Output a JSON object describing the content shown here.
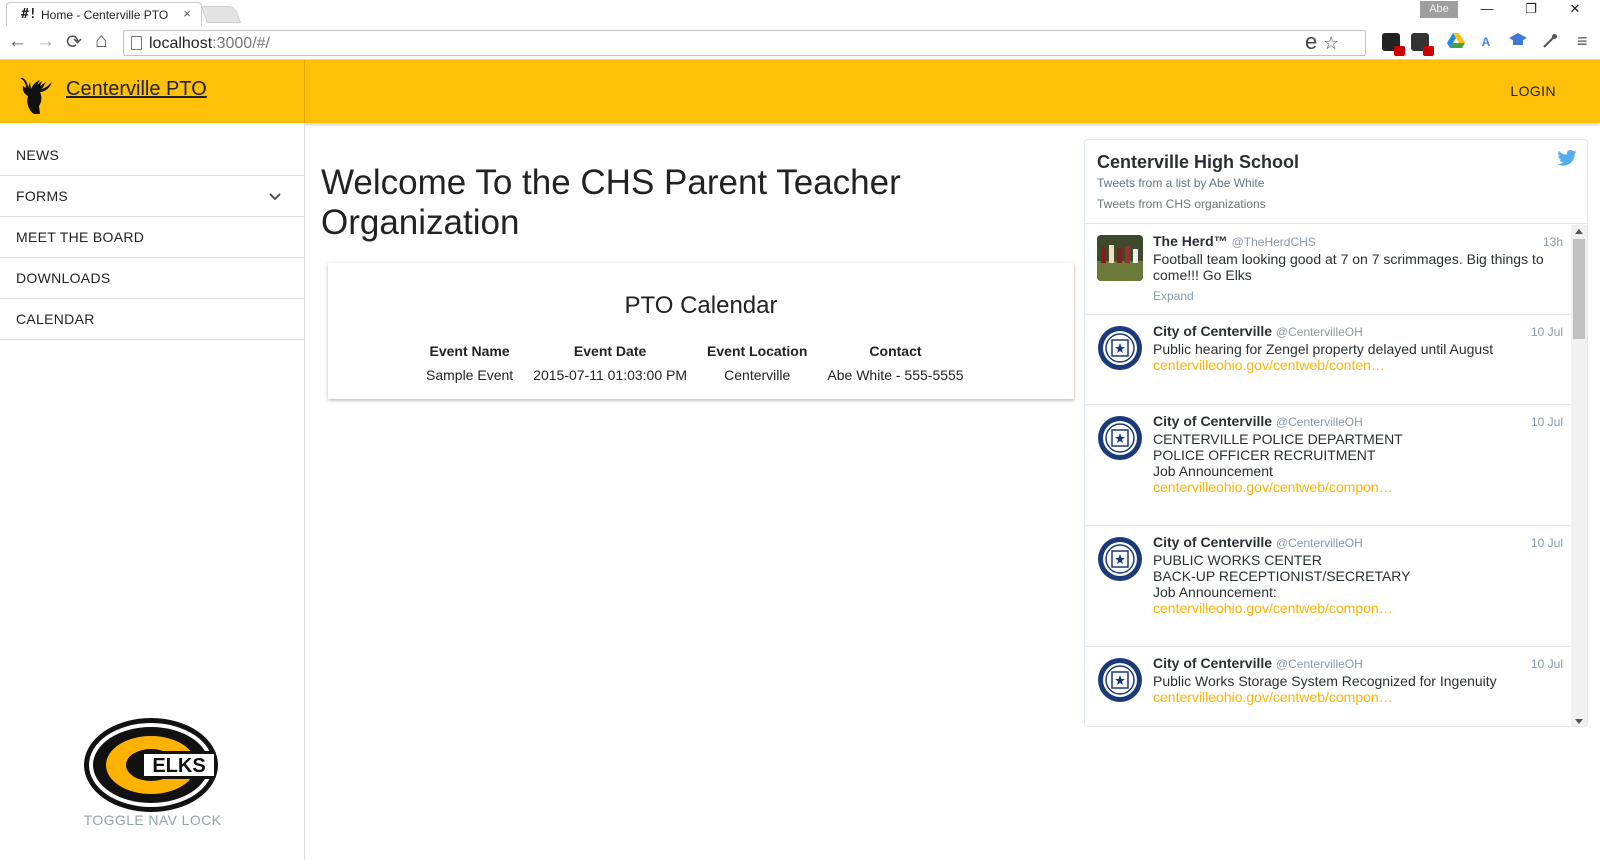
{
  "browser": {
    "tab_favicon": "#!",
    "tab_title": "Home - Centerville PTO",
    "tab_close": "×",
    "profile_name": "Abe",
    "url_host": "localhost",
    "url_rest": ":3000/#/",
    "window_controls": [
      "—",
      "❐",
      "✕"
    ],
    "nav_back": "←",
    "nav_forward": "→",
    "nav_reload": "⟳",
    "nav_home": "⌂",
    "star": "☆",
    "menu": "≡",
    "omni_e": "e"
  },
  "header": {
    "brand": "Centerville PTO",
    "login": "LOGIN",
    "accent_color": "#FFC107"
  },
  "sidebar": {
    "items": [
      {
        "label": "NEWS"
      },
      {
        "label": "FORMS",
        "has_submenu": true,
        "chevron": "⌄"
      },
      {
        "label": "MEET THE BOARD"
      },
      {
        "label": "DOWNLOADS"
      },
      {
        "label": "CALENDAR"
      }
    ],
    "logo_text": "ELKS",
    "toggle_label": "TOGGLE NAV LOCK"
  },
  "main": {
    "welcome": "Welcome To the CHS Parent Teacher Organization",
    "calendar": {
      "title": "PTO Calendar",
      "columns": [
        "Event Name",
        "Event Date",
        "Event Location",
        "Contact"
      ],
      "rows": [
        [
          "Sample Event",
          "2015-07-11 01:03:00 PM",
          "Centerville",
          "Abe White - 555-5555"
        ]
      ]
    }
  },
  "twitter": {
    "title": "Centerville High School",
    "sub1": "Tweets from a list by Abe White",
    "sub2": "Tweets from CHS organizations",
    "tweets": [
      {
        "name": "The Herd™",
        "handle": "@TheHerdCHS",
        "time": "13h",
        "text": "Football team looking good at 7 on 7 scrimmages. Big things to come!!! Go Elks",
        "link": "",
        "expand": "Expand"
      },
      {
        "name": "City of Centerville",
        "handle": "@CentervilleOH",
        "time": "10 Jul",
        "text": "Public hearing for Zengel property delayed until August",
        "link": " centervilleohio.gov/centweb/conten…",
        "expand": ""
      },
      {
        "name": "City of Centerville",
        "handle": "@CentervilleOH",
        "time": "10 Jul",
        "text": "CENTERVILLE POLICE DEPARTMENT\nPOLICE OFFICER RECRUITMENT\nJob Announcement",
        "link": "centervilleohio.gov/centweb/compon…",
        "expand": ""
      },
      {
        "name": "City of Centerville",
        "handle": "@CentervilleOH",
        "time": "10 Jul",
        "text": "PUBLIC WORKS CENTER\nBACK-UP RECEPTIONIST/SECRETARY\nJob Announcement:",
        "link": "centervilleohio.gov/centweb/compon…",
        "expand": ""
      },
      {
        "name": "City of Centerville",
        "handle": "@CentervilleOH",
        "time": "10 Jul",
        "text": "Public Works Storage System Recognized for Ingenuity",
        "link": " centervilleohio.gov/centweb/compon…",
        "expand": ""
      }
    ]
  }
}
